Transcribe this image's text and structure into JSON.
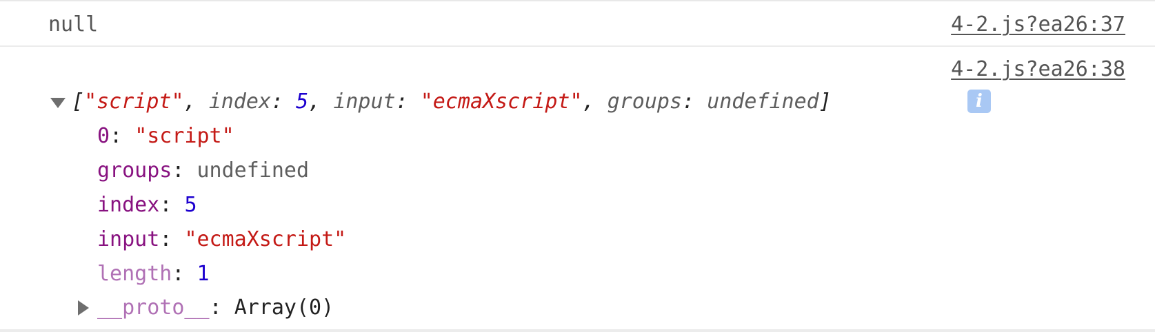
{
  "console": {
    "rows": [
      {
        "message": "null",
        "source": "4-2.js?ea26:37"
      },
      {
        "source": "4-2.js?ea26:38",
        "summary": {
          "open_bracket": "[",
          "first": "\"script\"",
          "sep1": ", ",
          "index_key": "index",
          "colon": ": ",
          "index_val": "5",
          "sep2": ", ",
          "input_key": "input",
          "input_val": "\"ecmaXscript\"",
          "sep3": ", ",
          "groups_key": "groups",
          "groups_val": "undefined",
          "close_bracket": "]"
        },
        "info_icon": "i",
        "props": [
          {
            "key": "0",
            "value": "\"script\"",
            "kind": "string"
          },
          {
            "key": "groups",
            "value": "undefined",
            "kind": "undefined"
          },
          {
            "key": "index",
            "value": "5",
            "kind": "number"
          },
          {
            "key": "input",
            "value": "\"ecmaXscript\"",
            "kind": "string"
          },
          {
            "key": "length",
            "value": "1",
            "kind": "number"
          },
          {
            "key": "__proto__",
            "value": "Array(0)",
            "kind": "object"
          }
        ],
        "colon": ": "
      }
    ]
  },
  "icons": {
    "expand_open": "triangle-down-icon",
    "expand_closed": "triangle-right-icon",
    "info": "info-icon"
  },
  "colors": {
    "key": "#881280",
    "key_nonenumerable": "#b071b5",
    "string": "#c41a16",
    "number": "#1c00cf",
    "undefined": "#5e5e5e",
    "info_badge": "#a9c8f4"
  }
}
